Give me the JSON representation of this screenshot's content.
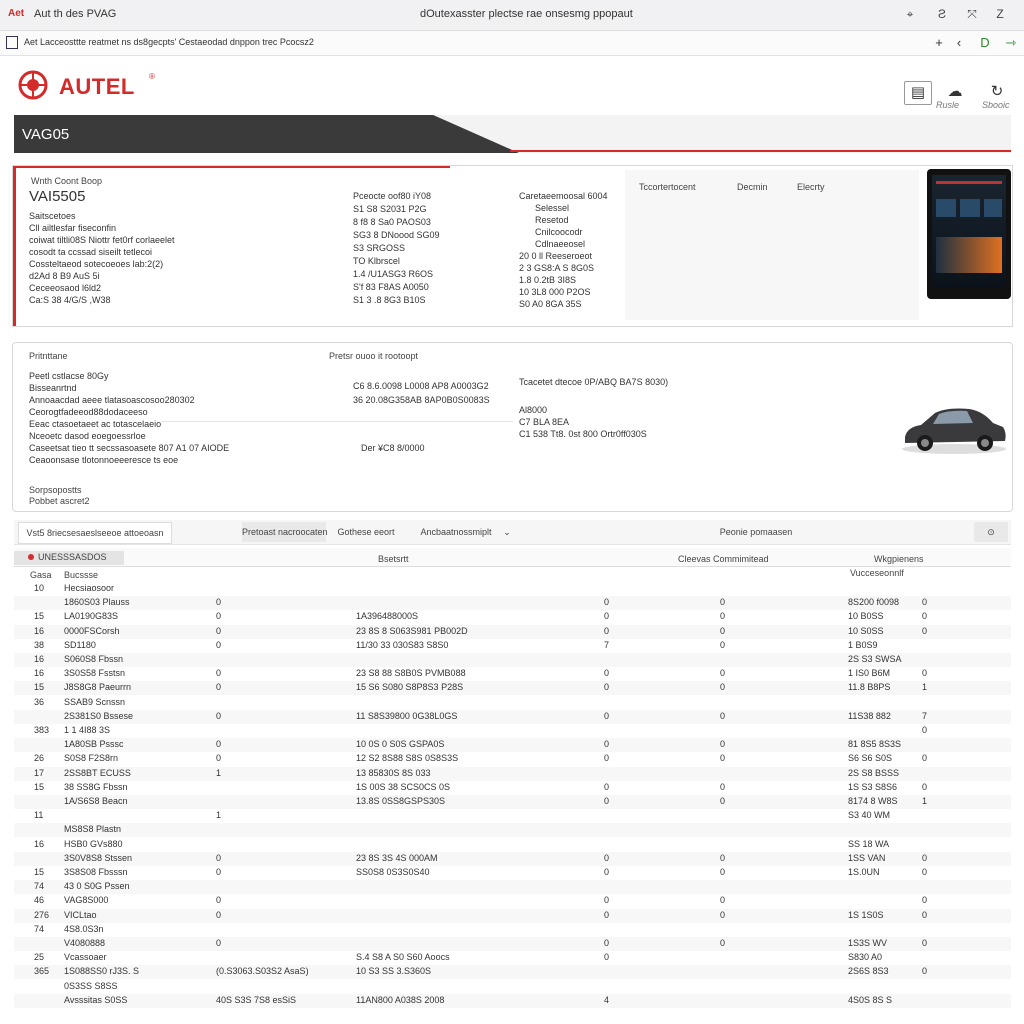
{
  "window": {
    "app_title": "Aut th des PVAG",
    "page_title": "dOutexasster plectse rae onsesmg ppopaut",
    "controls": [
      "⌖",
      "Ƨ",
      "⤧",
      "Z"
    ]
  },
  "addressbar": {
    "text": "Aet Lacceosttte reatmet ns ds8gecpts' Cestaeodad dnppon trec Pcocsz2",
    "nav": [
      "+",
      "‹",
      "D",
      "⇾"
    ]
  },
  "logo": {
    "brand": "AUTEL",
    "mark": "®"
  },
  "tools": [
    {
      "icon": "doc-icon",
      "glyph": "▤",
      "label": ""
    },
    {
      "icon": "cloud-icon",
      "glyph": "☁",
      "label": "Rusle"
    },
    {
      "icon": "refresh-icon",
      "glyph": "↻",
      "label": "Sbooic"
    }
  ],
  "section": {
    "title": "VAG05"
  },
  "overview": {
    "caption": "Wnth Coont Boop",
    "model": "VAI5505",
    "left_lines": [
      "Saitscetoes",
      "Cll ailtlesfar fiseconfin",
      "coiwat tiltli08S Niottr fet0rf corlaeelet",
      "cosodt ta ccssad siseilt tetlecoi",
      "Cossteltaeod sotecoeoes lab:2(2)",
      "d2Ad 8 B9 AuS 5i",
      "Ceceeosaod l6ld2",
      "Ca:S 38 4/G/S ,W38"
    ],
    "mid_lines": [
      "Pceocte oof80 iY08",
      "S1 S8 S2031 P2G",
      "8 f8 8 Sa0 PAOS03",
      "SG3 8 DNoood SG09",
      "S3 SRGOSS",
      "TO Klbrscel",
      "1.4 /U1ASG3 R6OS",
      "S'f 83 F8AS A0050",
      "S1 3 .8 8G3 B10S"
    ],
    "right_lines": [
      "Caretaeemoosal 6004",
      "Selessel",
      "Resetod",
      "Cnilcoocodr",
      "Cdlnaeeosel",
      "20 0 ll Reeseroeot",
      "2 3 GS8:A S 8G0S",
      "1.8 0.2tB 3I8S",
      "10 3L8 000 P2OS",
      "S0 A0 8GA 35S"
    ],
    "tabs": [
      "Tccortertocent",
      "Decmin",
      "Elecrty"
    ]
  },
  "vehicle": {
    "caption": "Pritnttane",
    "mid_caption": "Pretsr ouoo it rootoopt",
    "left_lines": [
      "Peetl cstlacse 80Gy",
      "Bisseanrtnd",
      "Annoaacdad aeee tlatasoascosoo280302",
      "Ceorogtfadeeod88dodaceeso",
      "Eeac ctasoetaeet ac totascelaeio",
      "Nceoetc dasod eoegoessrloe",
      "Caseetsat tieo tt secssasoasete 807 A1 07 AIODE",
      "Ceaoonsase tlotonnoeeeresce ts eoe"
    ],
    "mid_lines": [
      "C6 8.6.0098 L0008 AP8 A0003G2",
      "36 20.08G358AB 8AP0B0S0083S"
    ],
    "mid_lower": "Der  ¥C8 8/0000",
    "right_lines": [
      "Tcacetet dtecoe 0P/ABQ BA7S 8030)",
      "Al8000",
      "C7 BLA 8EA",
      "C1 538 Tt8. 0st 800 Ortr0ff030S"
    ],
    "footer_a": "Sorpsopostts",
    "footer_b": "Pobbet ascret2"
  },
  "toolbar": {
    "b1": "Vst5 8riecsesaeslseeoe attoeoasn",
    "b2": "Pretoast nacroocaten",
    "b3": "Gothese eeort",
    "b4": "Ancbaatnossmiplt",
    "b5": "Peonie pomaasen",
    "b6": "⊙"
  },
  "table": {
    "headers": {
      "h1": "UNESSSASDOS",
      "h2": "Bsetsrtt",
      "h3": "Cleevas Commimitead",
      "h4": "Wkgpienens"
    },
    "subheaders": {
      "s1": "Gasa",
      "s2": "Bucssse",
      "s3": "Vucceseonnlf"
    },
    "rows": [
      {
        "n": "10",
        "name": "Hecsiaosoor",
        "a": "",
        "code": "",
        "b": "",
        "c": "",
        "val": "",
        "d": ""
      },
      {
        "n": "",
        "name": "1860S03 Plauss",
        "a": "0",
        "code": "",
        "b": "0",
        "c": "0",
        "val": "8S200 f0098",
        "d": "0"
      },
      {
        "n": "15",
        "name": "LA0190G83S",
        "a": "0",
        "code": "1A396488000S",
        "b": "0",
        "c": "0",
        "val": "10 B0SS",
        "d": "0"
      },
      {
        "n": "16",
        "name": "0000FSCorsh",
        "a": "0",
        "code": "23 8S 8 S063S981 PB002D",
        "b": "0",
        "c": "0",
        "val": "10 S0SS",
        "d": "0"
      },
      {
        "n": "38",
        "name": "SD1180",
        "a": "0",
        "code": "11/30 33 030S83 S8S0",
        "b": "7",
        "c": "0",
        "val": "1 B0S9",
        "d": ""
      },
      {
        "n": "16",
        "name": "S060S8 Fbssn",
        "a": "",
        "code": "",
        "b": "",
        "c": "",
        "val": "2S S3 SWSA",
        "d": ""
      },
      {
        "n": "16",
        "name": "3S0S58 Fsstsn",
        "a": "0",
        "code": "23 S8 88 S8B0S PVMB088",
        "b": "0",
        "c": "0",
        "val": "1 I‌S0 B6M",
        "d": "0"
      },
      {
        "n": "15",
        "name": "J8S8G8 Paeurrn",
        "a": "0",
        "code": "15 S6 S080 S8P8S3 P28S",
        "b": "0",
        "c": "0",
        "val": "11.8 B8PS",
        "d": "1"
      },
      {
        "n": "36",
        "name": "SSAB9 Scnssn",
        "a": "",
        "code": "",
        "b": "",
        "c": "",
        "val": "",
        "d": ""
      },
      {
        "n": "",
        "name": "2S381S0 Bssese",
        "a": "0",
        "code": "11 S8S39800 0G38L0GS",
        "b": "0",
        "c": "0",
        "val": "11S38 882",
        "d": "7"
      },
      {
        "n": "383",
        "name": "1 1 4I88 3S",
        "a": "",
        "code": "",
        "b": "",
        "c": "",
        "val": "",
        "d": "0"
      },
      {
        "n": "",
        "name": "1A80SB Psssc",
        "a": "0",
        "code": "10 0S 0 S0S GSPA0S",
        "b": "0",
        "c": "0",
        "val": "81 8S5 8S3S",
        "d": ""
      },
      {
        "n": "26",
        "name": "S0S8 F2S8rn",
        "a": "0",
        "code": "12 S2 8S88 S8S 0S8S3S",
        "b": "0",
        "c": "0",
        "val": "S6 S6 S0S",
        "d": "0"
      },
      {
        "n": "17",
        "name": "2SS8BT ECUSS",
        "a": "1",
        "code": "13 85830S 8S 033",
        "b": "",
        "c": "",
        "val": "2S S8 BSSS",
        "d": ""
      },
      {
        "n": "15",
        "name": "38 SS8G Fbssn",
        "a": "",
        "code": "1S 00S 38 SCS0CS 0S",
        "b": "0",
        "c": "0",
        "val": "1S S3 S8S6",
        "d": "0"
      },
      {
        "n": "",
        "name": "1A/S6S8 Beacn",
        "a": "",
        "code": "13.8S 0SS8GSPS30S",
        "b": "0",
        "c": "0",
        "val": "8174 8 W8S",
        "d": "1"
      },
      {
        "n": "11",
        "name": "",
        "a": "1",
        "code": "",
        "b": "",
        "c": "",
        "val": "S3 40 W‌M",
        "d": ""
      },
      {
        "n": "",
        "name": "MS8S8 Plastn",
        "a": "",
        "code": "",
        "b": "",
        "c": "",
        "val": "",
        "d": ""
      },
      {
        "n": "16",
        "name": "HSB0 GVs880",
        "a": "",
        "code": "",
        "b": "",
        "c": "",
        "val": "SS 18 WA",
        "d": ""
      },
      {
        "n": "",
        "name": "3S0V8S8 Stssen",
        "a": "0",
        "code": "23 8S 3S 4S 000AM",
        "b": "0",
        "c": "0",
        "val": "1SS VAN",
        "d": "0"
      },
      {
        "n": "15",
        "name": "3S8S08 Fbsssn",
        "a": "0",
        "code": "SS0S8 0S3S0S40",
        "b": "0",
        "c": "0",
        "val": "1S.0UN",
        "d": "0"
      },
      {
        "n": "74",
        "name": "43 0 S0G Pssen",
        "a": "",
        "code": "",
        "b": "",
        "c": "",
        "val": "",
        "d": ""
      },
      {
        "n": "46",
        "name": "VAG8S000",
        "a": "0",
        "code": "",
        "b": "0",
        "c": "0",
        "val": "",
        "d": "0"
      },
      {
        "n": "276",
        "name": "VICLtao",
        "a": "0",
        "code": "",
        "b": "0",
        "c": "0",
        "val": "1S 1S0S",
        "d": "0"
      },
      {
        "n": "74",
        "name": "4S8.0S3n",
        "a": "",
        "code": "",
        "b": "",
        "c": "",
        "val": "",
        "d": ""
      },
      {
        "n": "",
        "name": "V4080888",
        "a": "0",
        "code": "",
        "b": "0",
        "c": "0",
        "val": "1S3S W‌V",
        "d": "0"
      },
      {
        "n": "25",
        "name": "Vcassoaer",
        "a": "",
        "code": "S.4 S8 A S0 S60 Aoocs",
        "b": "0",
        "c": "",
        "val": "S830 A0",
        "d": ""
      },
      {
        "n": "365",
        "name": "1S088SS0 rJ3S. S",
        "a": "(0.S3063.S03S2 AsaS)",
        "code": "10 S3 SS‌ 3.S360S",
        "b": "",
        "c": "",
        "val": "2S6S 8S3",
        "d": "0"
      },
      {
        "n": "",
        "name": "0S3SS‌ S8SS",
        "a": "",
        "code": "",
        "b": "",
        "c": "",
        "val": "",
        "d": ""
      },
      {
        "n": "",
        "name": "Avsssitas S0SS",
        "a": "40S S3S 7S8 esSiS",
        "code": "11AN800 A038S 2008",
        "b": "4",
        "c": "",
        "val": "4S0S 8S S",
        "d": ""
      }
    ]
  },
  "colors": {
    "accent": "#d42a2a",
    "dark": "#3a3a3a"
  }
}
